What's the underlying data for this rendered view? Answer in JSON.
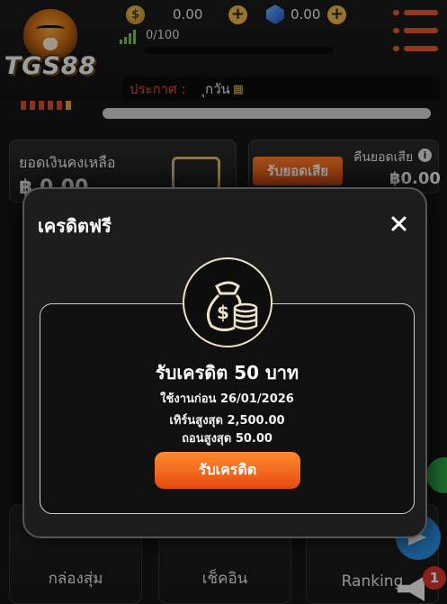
{
  "header": {
    "logo_text": "TGS88",
    "coin_symbol": "$",
    "coin_balance": "0.00",
    "gem_balance": "0.00",
    "plus_symbol": "+",
    "level_progress": "0/100",
    "level_fill_fraction": 0.0
  },
  "announcement": {
    "label": "ประกาศ :",
    "text": "ุกวัน",
    "icon": "money-icon"
  },
  "balance_card": {
    "title": "ยอดเงินคงเหลือ",
    "amount": "฿ 0.00"
  },
  "cashback_card": {
    "button_label": "รับยอดเสีย",
    "title": "คืนยอดเสีย",
    "info_symbol": "i",
    "amount": "฿0.00"
  },
  "bottom_nav": {
    "items": [
      {
        "label": "กล่องสุ่ม"
      },
      {
        "label": "เช็คอิน"
      },
      {
        "label": "Ranking"
      }
    ],
    "notification_count": "1"
  },
  "modal": {
    "title": "เครดิตฟรี",
    "promo": {
      "title": "รับเครดิต 50 บาท",
      "expiry": "ใช้งานก่อน 26/01/2026",
      "max_turnover": "เทิร์นสูงสุด 2,500.00",
      "max_withdraw": "ถอนสูงสุด 50.00",
      "claim_label": "รับเครดิต"
    }
  },
  "colors": {
    "accent_orange": "#e0572a",
    "announce_red": "#e04a3c",
    "gold": "#d9b77a"
  }
}
